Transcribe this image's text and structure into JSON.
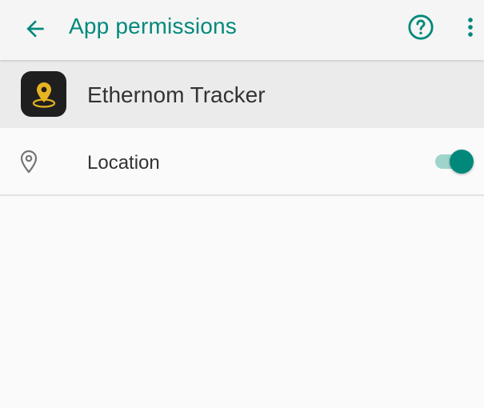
{
  "toolbar": {
    "title": "App permissions",
    "back_icon": "arrow-left-icon",
    "help_icon": "help-circle-icon",
    "more_icon": "more-vert-icon"
  },
  "app": {
    "name": "Ethernom Tracker",
    "icon": "location-pin-icon"
  },
  "permissions": [
    {
      "label": "Location",
      "icon": "location-pin-outline-icon",
      "enabled": true
    }
  ],
  "colors": {
    "accent": "#00897b",
    "toggle_track": "#9fd4cd",
    "app_icon_bg": "#1f1f1f",
    "app_icon_pin": "#e6b422",
    "toolbar_bg": "#f5f5f5",
    "header_bg": "#ebebeb"
  }
}
